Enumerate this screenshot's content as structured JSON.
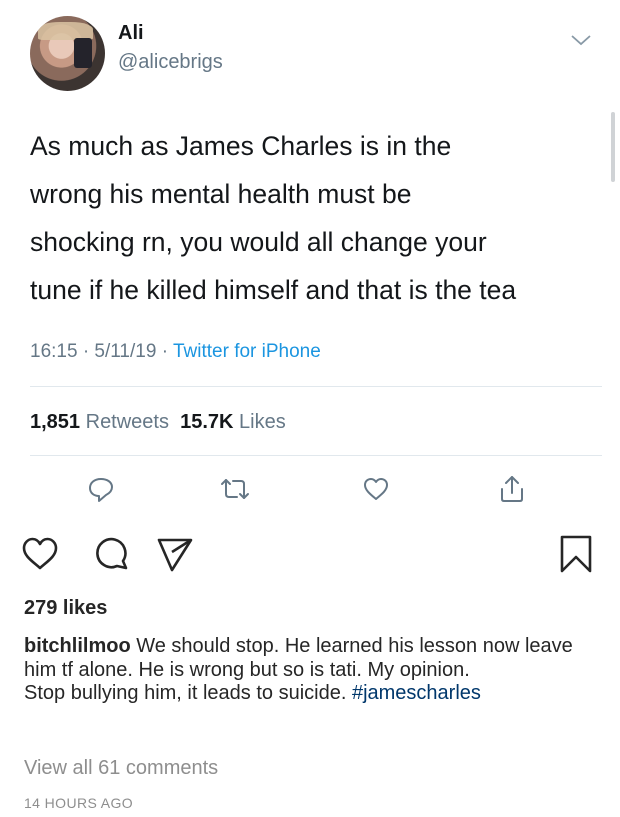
{
  "tweet": {
    "display_name": "Ali",
    "handle": "@alicebrigs",
    "text_lines": [
      "As much as James Charles is in the",
      "wrong his mental health must be",
      "shocking rn, you would all change your",
      "tune if he killed himself and that is the tea"
    ],
    "timestamp": "16:15 · 5/11/19 · ",
    "source": "Twitter for iPhone",
    "retweets_count": "1,851",
    "retweets_label": " Retweets",
    "likes_count": "15.7K",
    "likes_label": " Likes",
    "icons": [
      "reply-icon",
      "retweet-icon",
      "like-icon",
      "share-icon",
      "chevron-down-icon"
    ],
    "link_color": "#1b95e0"
  },
  "instagram": {
    "likes": "279 likes",
    "username": "bitchlilmoo",
    "caption": " We should stop. He learned his lesson now leave him tf alone. He is wrong but so is tati. My opinion.",
    "caption_line2": "Stop bullying him, it leads to suicide. ",
    "hashtag": "#jamescharles",
    "view_all": "View all 61 comments",
    "time_ago": "14 HOURS AGO",
    "icons": [
      "heart-icon",
      "comment-icon",
      "send-icon",
      "bookmark-icon"
    ],
    "hashtag_color": "#00376b"
  }
}
